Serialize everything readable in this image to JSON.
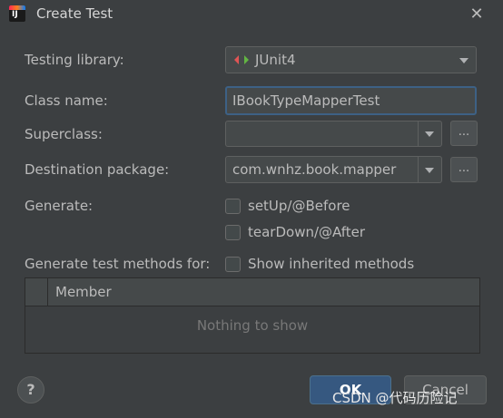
{
  "window": {
    "title": "Create Test"
  },
  "form": {
    "testing_library_label": "Testing library:",
    "testing_library_value": "JUnit4",
    "class_name_label": "Class name:",
    "class_name_value": "IBookTypeMapperTest",
    "superclass_label": "Superclass:",
    "superclass_value": "",
    "destination_package_label": "Destination package:",
    "destination_package_value": "com.wnhz.book.mapper",
    "generate_label": "Generate:",
    "setup_label": "setUp/@Before",
    "setup_checked": false,
    "teardown_label": "tearDown/@After",
    "teardown_checked": false,
    "methods_label": "Generate test methods for:",
    "inherited_label": "Show inherited methods",
    "inherited_checked": false,
    "browse_label": "..."
  },
  "table": {
    "column_member": "Member",
    "empty_text": "Nothing to show"
  },
  "footer": {
    "help_label": "?",
    "ok_label": "OK",
    "cancel_label": "Cancel"
  },
  "watermark": "CSDN @代码历险记",
  "icons": {
    "app": "intellij-idea-icon",
    "close": "close-icon",
    "junit": "junit-diamond-icon"
  },
  "colors": {
    "background": "#3c3f41",
    "field": "#45494a",
    "focus_border": "#3d6185",
    "ok_button": "#365880",
    "junit_green": "#62b543",
    "junit_red": "#e05555"
  }
}
